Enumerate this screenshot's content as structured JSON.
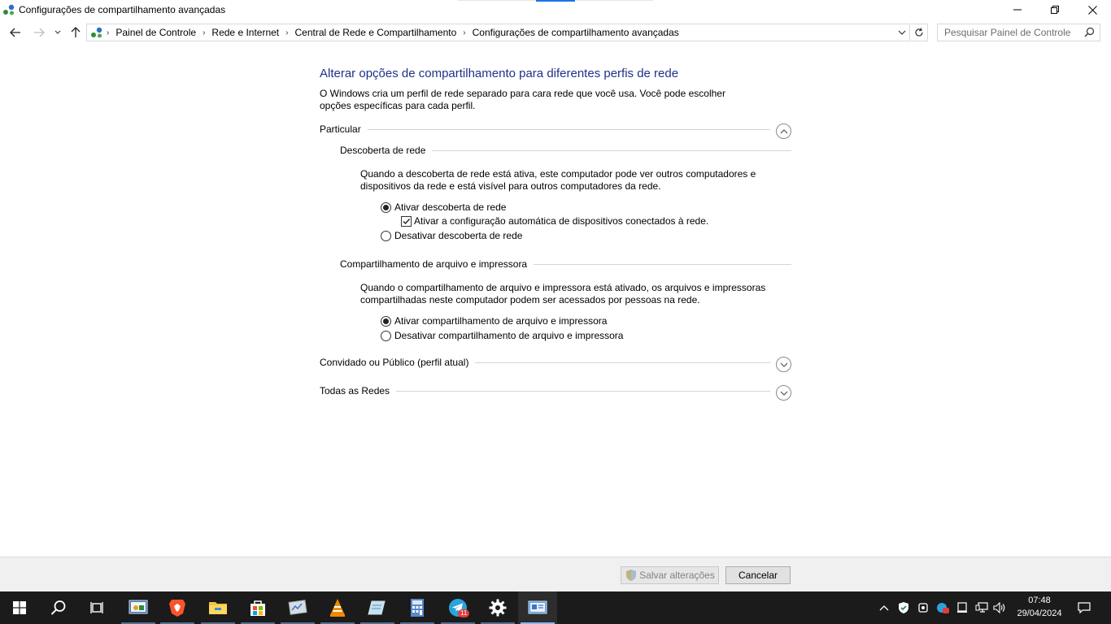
{
  "window": {
    "title": "Configurações de compartilhamento avançadas"
  },
  "address_bar": {
    "breadcrumbs": [
      "Painel de Controle",
      "Rede e Internet",
      "Central de Rede e Compartilhamento",
      "Configurações de compartilhamento avançadas"
    ],
    "search_placeholder": "Pesquisar Painel de Controle"
  },
  "content": {
    "heading": "Alterar opções de compartilhamento para diferentes perfis de rede",
    "intro": "O Windows cria um perfil de rede separado para cara rede que você usa. Você pode escolher opções específicas para cada perfil.",
    "profiles": [
      {
        "name": "Particular",
        "expanded": true,
        "sections": [
          {
            "title": "Descoberta de rede",
            "description": "Quando a descoberta de rede está ativa, este computador pode ver outros computadores e dispositivos da rede e está visível para outros computadores da rede.",
            "options": [
              {
                "type": "radio",
                "label": "Ativar descoberta de rede",
                "checked": true
              },
              {
                "type": "checkbox",
                "label": "Ativar a configuração automática de dispositivos conectados à rede.",
                "checked": true
              },
              {
                "type": "radio",
                "label": "Desativar descoberta de rede",
                "checked": false
              }
            ]
          },
          {
            "title": "Compartilhamento de arquivo e impressora",
            "description": "Quando o compartilhamento de arquivo e impressora está ativado, os arquivos e impressoras compartilhadas neste computador podem ser acessados por pessoas na rede.",
            "options": [
              {
                "type": "radio",
                "label": "Ativar compartilhamento de arquivo e impressora",
                "checked": true
              },
              {
                "type": "radio",
                "label": "Desativar compartilhamento de arquivo e impressora",
                "checked": false
              }
            ]
          }
        ]
      },
      {
        "name": "Convidado ou Público (perfil atual)",
        "expanded": false
      },
      {
        "name": "Todas as Redes",
        "expanded": false
      }
    ]
  },
  "buttons": {
    "save": "Salvar alterações",
    "cancel": "Cancelar"
  },
  "taskbar": {
    "items": [
      "start-icon",
      "search-icon",
      "task-view-icon",
      "control-panel-icon",
      "brave-browser-icon",
      "file-explorer-icon",
      "microsoft-store-icon",
      "system-monitor-icon",
      "vlc-icon",
      "notepad-icon",
      "calculator-icon",
      "telegram-icon",
      "settings-icon",
      "network-center-icon"
    ],
    "telegram_badge": "11",
    "clock_time": "07:48",
    "clock_date": "29/04/2024"
  },
  "colors": {
    "heading_blue": "#1e3287",
    "taskbar_bg": "#1b1b1b",
    "command_bar_bg": "#f0f0f0"
  }
}
